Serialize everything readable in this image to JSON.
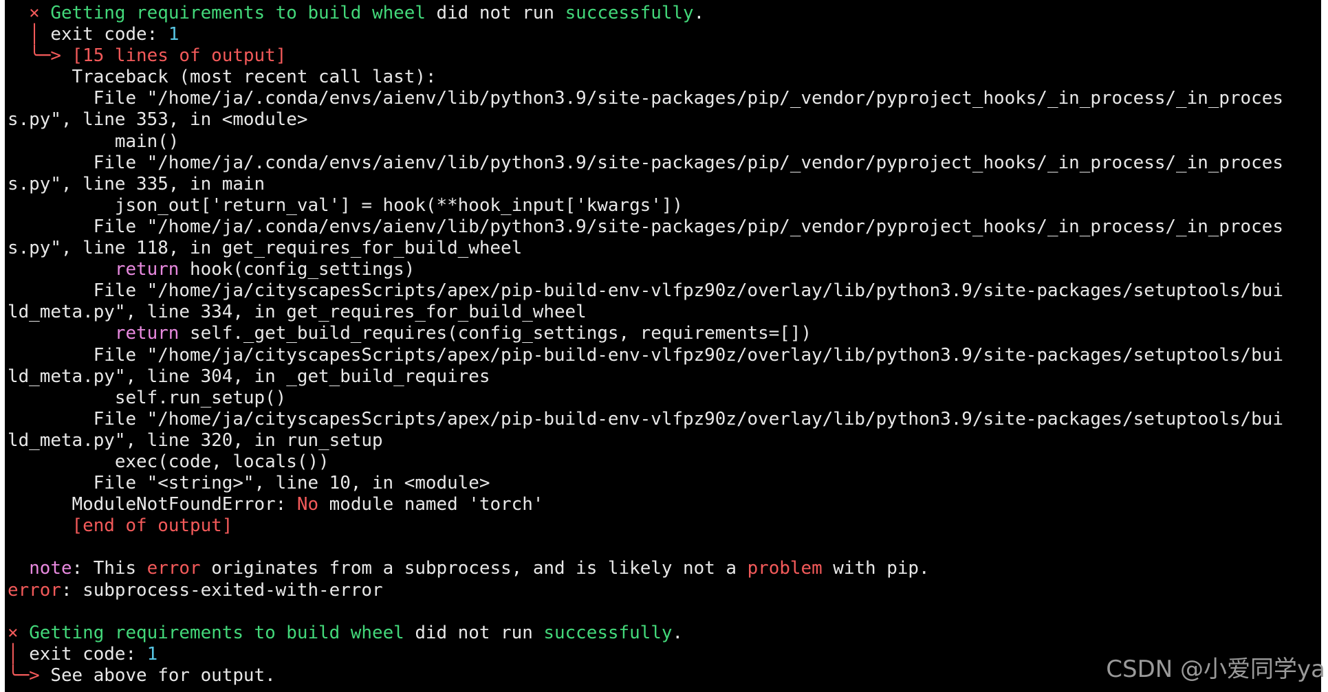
{
  "colors": {
    "background": "#000000",
    "default_text": "#e8e8e8",
    "green": "#43d87a",
    "red": "#f35a5a",
    "pink": "#ff7fa8",
    "magenta": "#e98ae0",
    "cyan": "#58c6e4"
  },
  "terminal": {
    "lines": [
      {
        "segments": [
          {
            "t": "  × ",
            "c": "red"
          },
          {
            "t": "Getting requirements to build wheel",
            "c": "green"
          },
          {
            "t": " did not run ",
            "c": "white"
          },
          {
            "t": "successfully",
            "c": "green"
          },
          {
            "t": ".",
            "c": "white"
          }
        ]
      },
      {
        "segments": [
          {
            "t": "  │ ",
            "c": "red"
          },
          {
            "t": "exit code: ",
            "c": "white"
          },
          {
            "t": "1",
            "c": "cyan"
          }
        ]
      },
      {
        "segments": [
          {
            "t": "  ╰─> ",
            "c": "red"
          },
          {
            "t": "[15 lines of output]",
            "c": "red"
          }
        ]
      },
      {
        "segments": [
          {
            "t": "      Traceback (most recent call last):",
            "c": "white"
          }
        ]
      },
      {
        "segments": [
          {
            "t": "        File \"/home/ja/.conda/envs/aienv/lib/python3.9/site-packages/pip/_vendor/pyproject_hooks/_in_process/_in_proces",
            "c": "white"
          }
        ]
      },
      {
        "segments": [
          {
            "t": "s.py\", line 353, in <module>",
            "c": "white"
          }
        ]
      },
      {
        "segments": [
          {
            "t": "          main()",
            "c": "white"
          }
        ]
      },
      {
        "segments": [
          {
            "t": "        File \"/home/ja/.conda/envs/aienv/lib/python3.9/site-packages/pip/_vendor/pyproject_hooks/_in_process/_in_proces",
            "c": "white"
          }
        ]
      },
      {
        "segments": [
          {
            "t": "s.py\", line 335, in main",
            "c": "white"
          }
        ]
      },
      {
        "segments": [
          {
            "t": "          json_out['return_val'] = hook(**hook_input['kwargs'])",
            "c": "white"
          }
        ]
      },
      {
        "segments": [
          {
            "t": "        File \"/home/ja/.conda/envs/aienv/lib/python3.9/site-packages/pip/_vendor/pyproject_hooks/_in_process/_in_proces",
            "c": "white"
          }
        ]
      },
      {
        "segments": [
          {
            "t": "s.py\", line 118, in get_requires_for_build_wheel",
            "c": "white"
          }
        ]
      },
      {
        "segments": [
          {
            "t": "          ",
            "c": "white"
          },
          {
            "t": "return",
            "c": "magenta"
          },
          {
            "t": " hook(config_settings)",
            "c": "white"
          }
        ]
      },
      {
        "segments": [
          {
            "t": "        File \"/home/ja/cityscapesScripts/apex/pip-build-env-vlfpz90z/overlay/lib/python3.9/site-packages/setuptools/bui",
            "c": "white"
          }
        ]
      },
      {
        "segments": [
          {
            "t": "ld_meta.py\", line 334, in get_requires_for_build_wheel",
            "c": "white"
          }
        ]
      },
      {
        "segments": [
          {
            "t": "          ",
            "c": "white"
          },
          {
            "t": "return",
            "c": "magenta"
          },
          {
            "t": " self._get_build_requires(config_settings, requirements=[])",
            "c": "white"
          }
        ]
      },
      {
        "segments": [
          {
            "t": "        File \"/home/ja/cityscapesScripts/apex/pip-build-env-vlfpz90z/overlay/lib/python3.9/site-packages/setuptools/bui",
            "c": "white"
          }
        ]
      },
      {
        "segments": [
          {
            "t": "ld_meta.py\", line 304, in _get_build_requires",
            "c": "white"
          }
        ]
      },
      {
        "segments": [
          {
            "t": "          self.run_setup()",
            "c": "white"
          }
        ]
      },
      {
        "segments": [
          {
            "t": "        File \"/home/ja/cityscapesScripts/apex/pip-build-env-vlfpz90z/overlay/lib/python3.9/site-packages/setuptools/bui",
            "c": "white"
          }
        ]
      },
      {
        "segments": [
          {
            "t": "ld_meta.py\", line 320, in run_setup",
            "c": "white"
          }
        ]
      },
      {
        "segments": [
          {
            "t": "          exec(code, locals())",
            "c": "white"
          }
        ]
      },
      {
        "segments": [
          {
            "t": "        File \"<string>\", line 10, in <module>",
            "c": "white"
          }
        ]
      },
      {
        "segments": [
          {
            "t": "      ModuleNotFoundError: ",
            "c": "white"
          },
          {
            "t": "No",
            "c": "red"
          },
          {
            "t": " module named 'torch'",
            "c": "white"
          }
        ]
      },
      {
        "segments": [
          {
            "t": "      ",
            "c": "white"
          },
          {
            "t": "[end of output]",
            "c": "red"
          }
        ]
      },
      {
        "segments": [
          {
            "t": " ",
            "c": "white"
          }
        ]
      },
      {
        "segments": [
          {
            "t": "  ",
            "c": "white"
          },
          {
            "t": "note",
            "c": "magenta"
          },
          {
            "t": ": This ",
            "c": "white"
          },
          {
            "t": "error",
            "c": "red"
          },
          {
            "t": " originates from a subprocess, and is likely not a ",
            "c": "white"
          },
          {
            "t": "problem",
            "c": "red"
          },
          {
            "t": " with pip.",
            "c": "white"
          }
        ]
      },
      {
        "segments": [
          {
            "t": "error",
            "c": "red"
          },
          {
            "t": ": subprocess-exited-with-error",
            "c": "white"
          }
        ]
      },
      {
        "segments": [
          {
            "t": " ",
            "c": "white"
          }
        ]
      },
      {
        "segments": [
          {
            "t": "× ",
            "c": "red"
          },
          {
            "t": "Getting requirements to build wheel",
            "c": "green"
          },
          {
            "t": " did not run ",
            "c": "white"
          },
          {
            "t": "successfully",
            "c": "green"
          },
          {
            "t": ".",
            "c": "white"
          }
        ]
      },
      {
        "segments": [
          {
            "t": "│ ",
            "c": "red"
          },
          {
            "t": "exit code: ",
            "c": "white"
          },
          {
            "t": "1",
            "c": "cyan"
          }
        ]
      },
      {
        "segments": [
          {
            "t": "╰─> ",
            "c": "red"
          },
          {
            "t": "See above for output.",
            "c": "white"
          }
        ]
      }
    ]
  },
  "watermark": "CSDN @小爱同学ya"
}
